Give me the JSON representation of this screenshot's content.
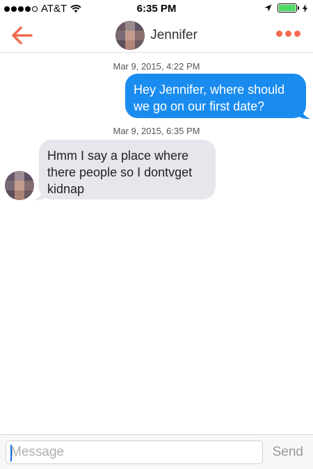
{
  "status_bar": {
    "carrier": "AT&T",
    "time": "6:35 PM",
    "signal_bars": 5,
    "signal_filled": 4,
    "battery_level": 1.0,
    "icons": [
      "signal-dots-icon",
      "wifi-icon",
      "location-arrow-icon",
      "battery-icon",
      "charging-bolt-icon"
    ]
  },
  "nav": {
    "title": "Jennifer",
    "back_icon": "arrow-left-icon",
    "more_icon": "ellipsis-icon",
    "accent_color": "#f26b4f"
  },
  "messages": [
    {
      "timestamp": "Mar 9, 2015, 4:22 PM",
      "direction": "sent",
      "text": "Hey Jennifer, where should we go on our first date?",
      "bubble_color": "#1a8cf0"
    },
    {
      "timestamp": "Mar 9, 2015, 6:35 PM",
      "direction": "received",
      "text": "Hmm I say a place where there people so I dontvget kidnap",
      "bubble_color": "#e6e6ec"
    }
  ],
  "composer": {
    "placeholder": "Message",
    "value": "",
    "send_label": "Send"
  }
}
